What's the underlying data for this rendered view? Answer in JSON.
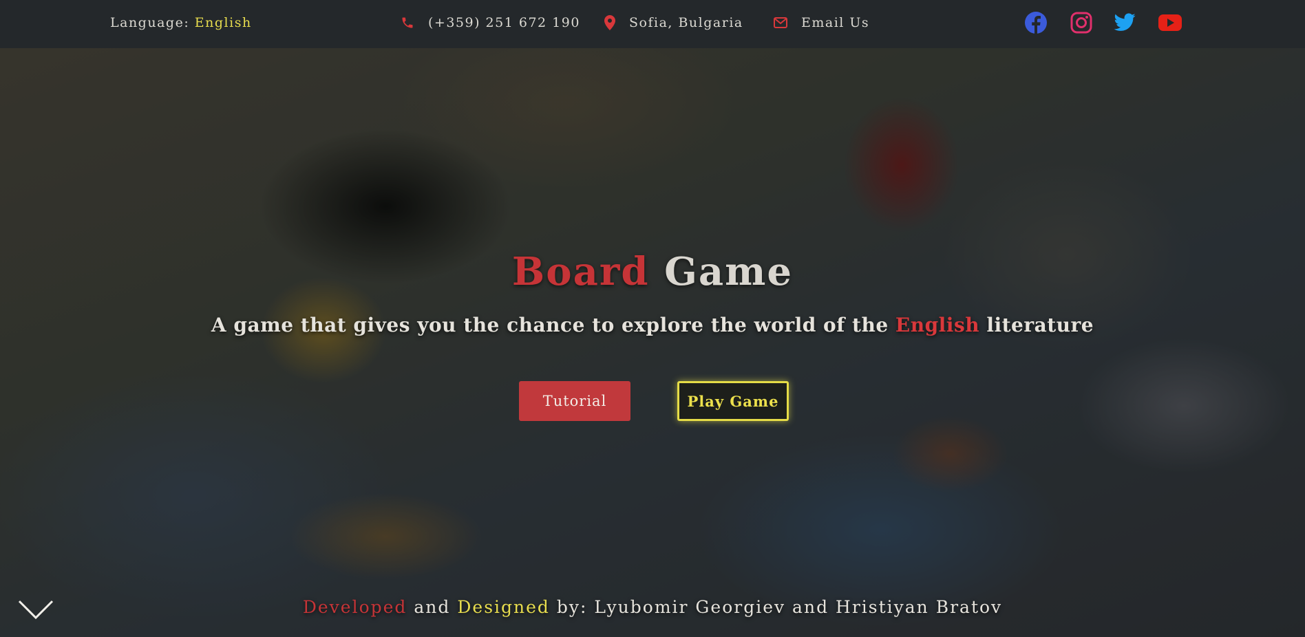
{
  "topbar": {
    "language_label": "Language:",
    "language_value": "English",
    "phone": "(+359) 251 672 190",
    "location": "Sofia, Bulgaria",
    "email": "Email Us",
    "social": [
      "facebook-icon",
      "instagram-icon",
      "twitter-icon",
      "youtube-icon"
    ]
  },
  "hero": {
    "title_word1": "Board",
    "title_word2": "Game",
    "subtitle_before": "A game that gives you the chance to explore the world of the",
    "subtitle_highlight": "English",
    "subtitle_after": "literature",
    "tutorial_label": "Tutorial",
    "play_label": "Play Game"
  },
  "footer": {
    "developed": "Developed",
    "and1": "and",
    "designed": "Designed",
    "by_names": "by: Lyubomir Georgiev and Hristiyan Bratov"
  },
  "colors": {
    "accent_red": "#c63437",
    "accent_yellow": "#e8dd4e",
    "topbar_bg": "#24282b",
    "facebook": "#3b5bdb",
    "instagram": "#e1306c",
    "twitter": "#1da1f2",
    "youtube": "#e62117"
  }
}
